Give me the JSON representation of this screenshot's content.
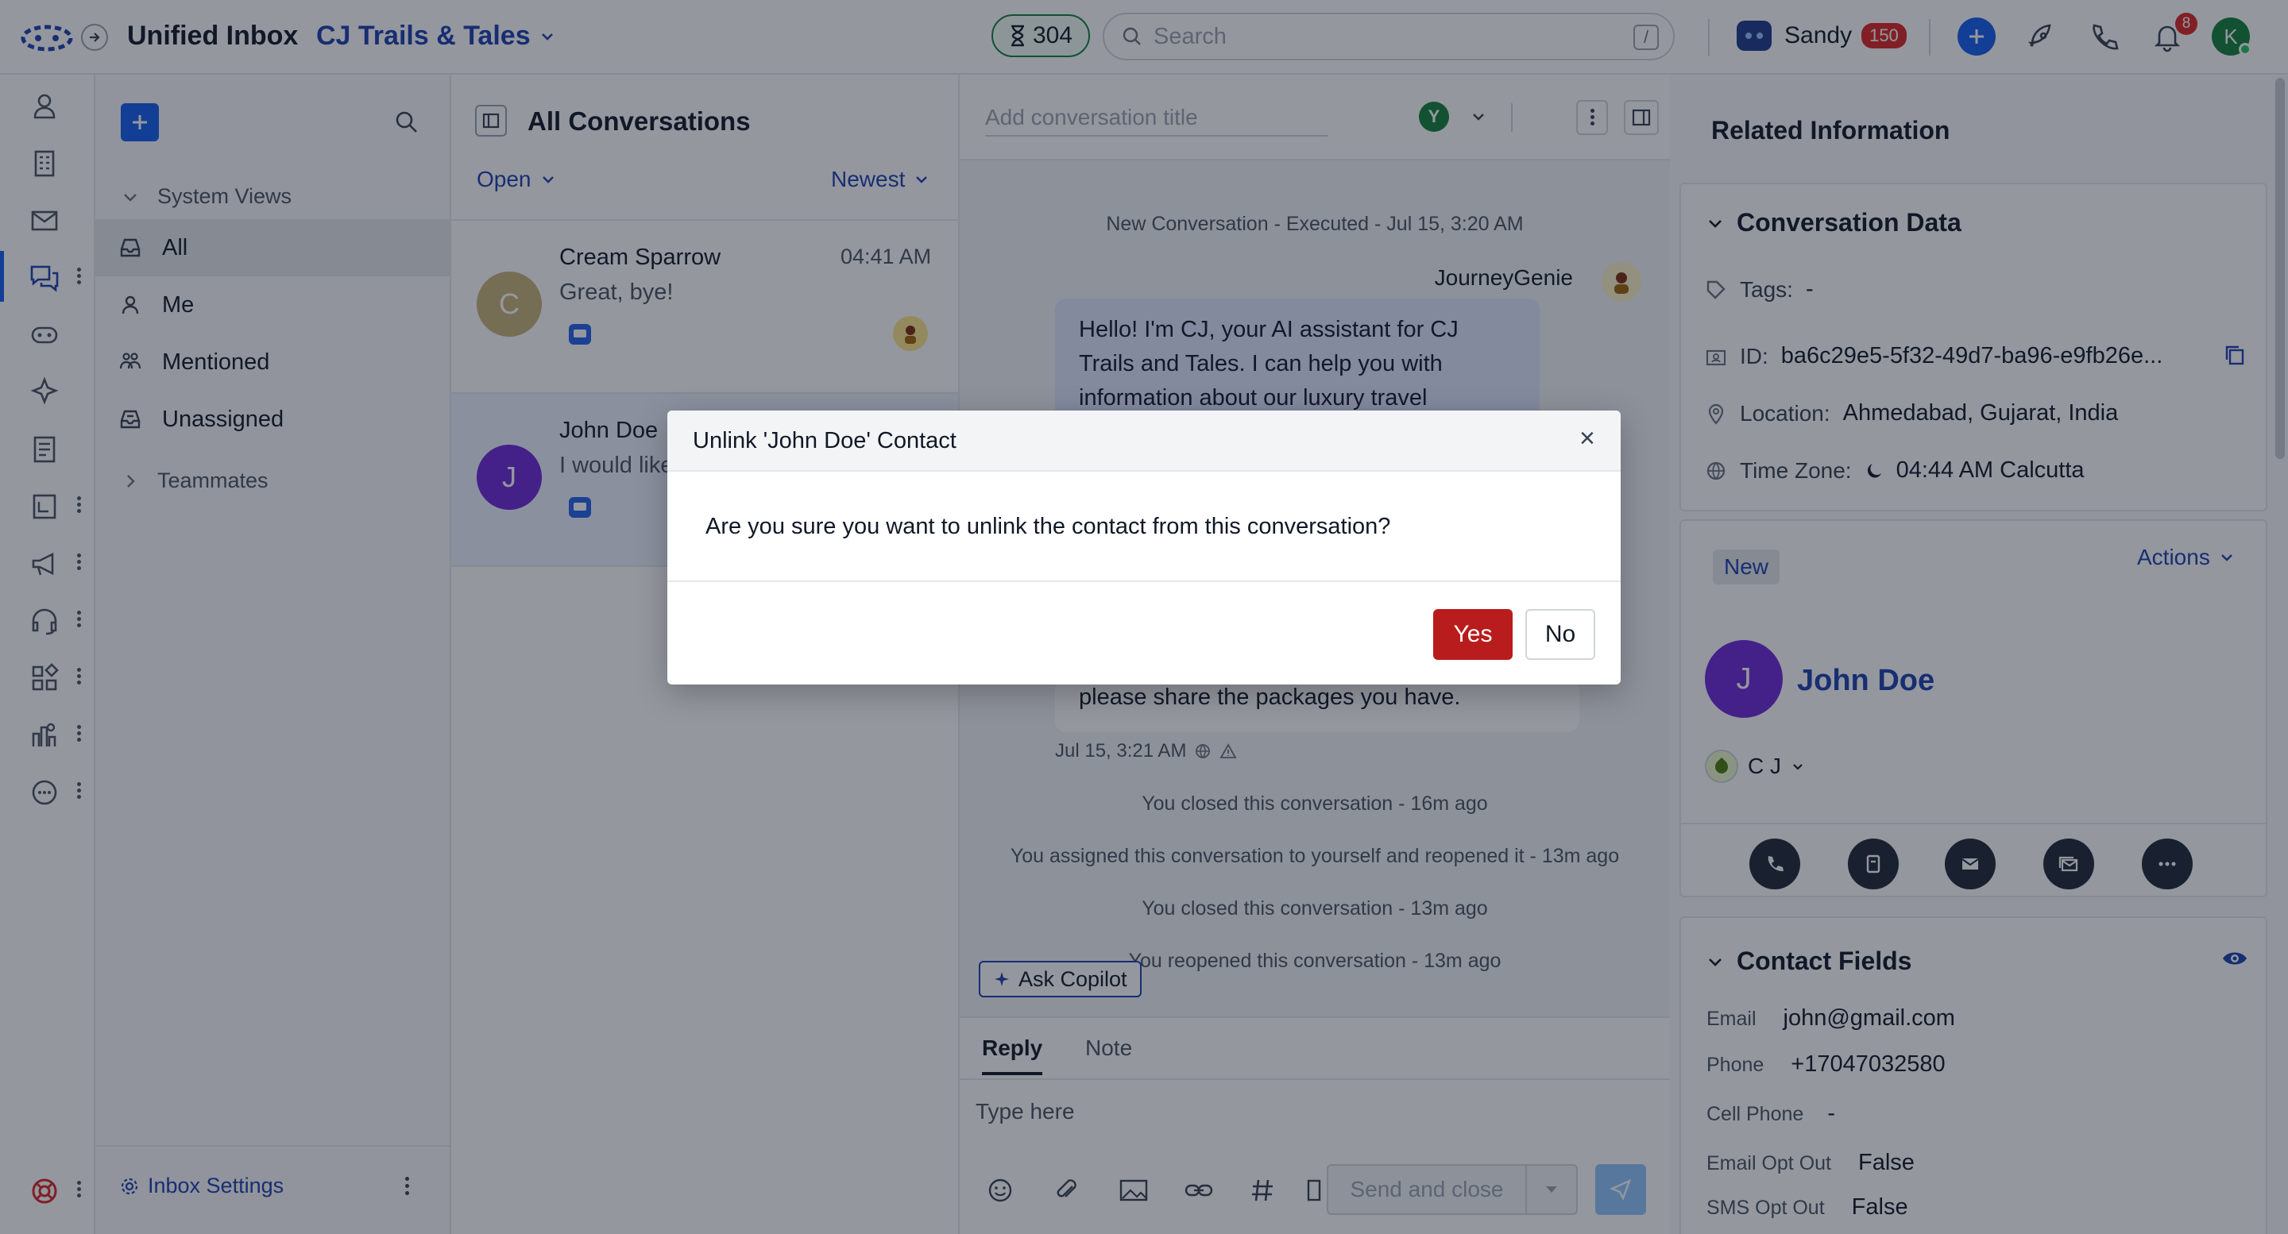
{
  "app": {
    "title": "Unified Inbox",
    "location": "CJ Trails & Tales",
    "counter": "304",
    "search_placeholder": "Search",
    "search_shortcut": "/",
    "user_name": "Sandy",
    "user_badge": "150",
    "notif_count": "8",
    "avatar_initial": "K"
  },
  "colors": {
    "brand": "#1e40af",
    "accent": "#155eef",
    "danger": "#b91c1c",
    "online": "#16a34a"
  },
  "inbox_nav": {
    "system_views": "System Views",
    "items": [
      "All",
      "Me",
      "Mentioned",
      "Unassigned"
    ],
    "teammates": "Teammates",
    "settings": "Inbox Settings"
  },
  "conv_list": {
    "title": "All Conversations",
    "filter": "Open",
    "sort": "Newest",
    "items": [
      {
        "initial": "C",
        "name": "Cream Sparrow",
        "preview": "Great, bye!",
        "time": "04:41 AM"
      },
      {
        "initial": "J",
        "name": "John Doe",
        "preview": "I would like"
      }
    ]
  },
  "chat": {
    "title_placeholder": "Add conversation title",
    "assignee": "Y",
    "event_new": "New Conversation - Executed - Jul 15, 3:20 AM",
    "bot_name": "JourneyGenie",
    "bot_message": "Hello! I'm CJ, your AI assistant for CJ Trails and Tales. I can help you with information about our luxury travel services,",
    "user_msg_tail": "please share the packages you have.",
    "msg_time": "Jul 15, 3:21 AM",
    "events": [
      "You closed this conversation - 16m ago",
      "You assigned this conversation to yourself and reopened it - 13m ago",
      "You closed this conversation - 13m ago",
      "You reopened this conversation - 13m ago"
    ],
    "ask_copilot": "Ask Copilot",
    "tab_reply": "Reply",
    "tab_note": "Note",
    "compose_placeholder": "Type here",
    "send_close": "Send and close"
  },
  "related": {
    "header": "Related Information",
    "conv_data_title": "Conversation Data",
    "tags_label": "Tags:",
    "tags_value": "-",
    "id_label": "ID:",
    "id_value": "ba6c29e5-5f32-49d7-ba96-e9fb26e...",
    "location_label": "Location:",
    "location_value": "Ahmedabad, Gujarat, India",
    "tz_label": "Time Zone:",
    "tz_value": "04:44 AM Calcutta",
    "status_badge": "New",
    "actions": "Actions",
    "contact_initial": "J",
    "contact_name": "John Doe",
    "owner": "C J",
    "contact_fields_title": "Contact Fields",
    "fields": [
      {
        "label": "Email",
        "value": "john@gmail.com"
      },
      {
        "label": "Phone",
        "value": "+17047032580"
      },
      {
        "label": "Cell Phone",
        "value": "-"
      },
      {
        "label": "Email Opt Out",
        "value": "False"
      },
      {
        "label": "SMS Opt Out",
        "value": "False"
      }
    ]
  },
  "modal": {
    "title": "Unlink 'John Doe' Contact",
    "body": "Are you sure you want to unlink the contact from this conversation?",
    "yes": "Yes",
    "no": "No",
    "close": "×"
  }
}
